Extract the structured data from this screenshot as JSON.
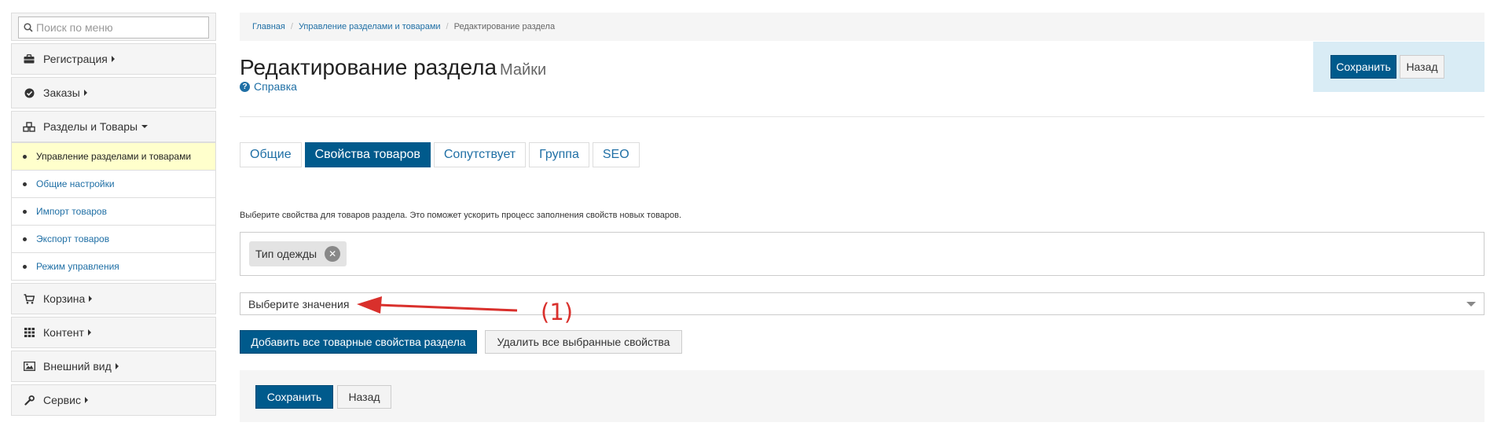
{
  "sidebar": {
    "search_placeholder": "Поиск по меню",
    "items": [
      {
        "label": "Регистрация",
        "icon": "briefcase-icon"
      },
      {
        "label": "Заказы",
        "icon": "check-circle-icon"
      },
      {
        "label": "Разделы и Товары",
        "icon": "cubes-icon"
      }
    ],
    "submenu": [
      {
        "label": "Управление разделами и товарами"
      },
      {
        "label": "Общие настройки"
      },
      {
        "label": "Импорт товаров"
      },
      {
        "label": "Экспорт товаров"
      },
      {
        "label": "Режим управления"
      }
    ],
    "items_bottom": [
      {
        "label": "Корзина",
        "icon": "cart-icon"
      },
      {
        "label": "Контент",
        "icon": "grid-icon"
      },
      {
        "label": "Внешний вид",
        "icon": "image-icon"
      },
      {
        "label": "Сервис",
        "icon": "wrench-icon"
      }
    ]
  },
  "breadcrumb": {
    "home": "Главная",
    "section": "Управление разделами и товарами",
    "current": "Редактирование раздела"
  },
  "page": {
    "title": "Редактирование раздела",
    "subtitle": "Майки",
    "help": "Справка"
  },
  "actions": {
    "save": "Сохранить",
    "back": "Назад"
  },
  "tabs": [
    {
      "label": "Общие",
      "active": false
    },
    {
      "label": "Свойства товаров",
      "active": true
    },
    {
      "label": "Сопутствует",
      "active": false
    },
    {
      "label": "Группа",
      "active": false
    },
    {
      "label": "SEO",
      "active": false
    }
  ],
  "properties": {
    "hint": "Выберите свойства для товаров раздела. Это поможет ускорить процесс заполнения свойств новых товаров.",
    "tag": "Тип одежды",
    "select_placeholder": "Выберите значения",
    "add_all": "Добавить все товарные свойства раздела",
    "remove_all": "Удалить все выбранные свойства"
  },
  "annotation": {
    "label": "(1)",
    "color": "#d9302c"
  },
  "colors": {
    "primary": "#005a8c",
    "link": "#1f6fa5",
    "active_sub_bg": "#ffffcc",
    "actions_bg": "#d9ecf5"
  }
}
